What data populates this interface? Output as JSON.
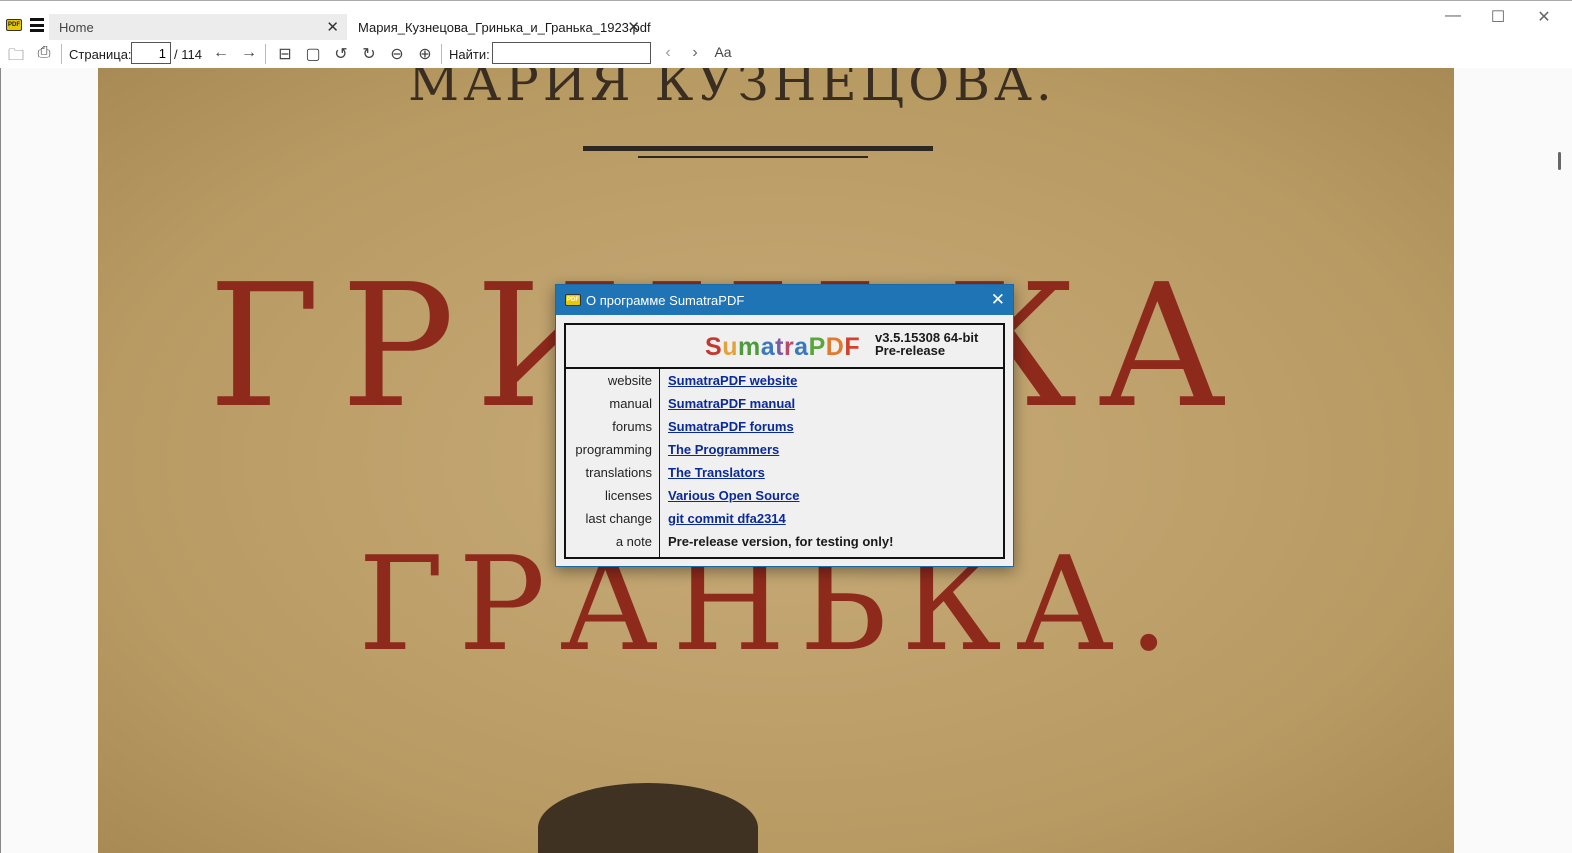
{
  "tabs": {
    "home": "Home",
    "doc": "Мария_Кузнецова_Гринька_и_Гранька_1923.pdf"
  },
  "toolbar": {
    "page_label": "Страница:",
    "page_value": "1",
    "page_total": "/ 114",
    "find_label": "Найти:",
    "find_value": "",
    "match_case": "Aa"
  },
  "document": {
    "author": "МАРИЯ КУЗНЕЦОВА.",
    "title1": "ГРИНЬКА",
    "title2": "ГРАНЬКА."
  },
  "dialog": {
    "title": "О программе SumatraPDF",
    "brand_letters": [
      {
        "c": "S",
        "color": "#c8372d"
      },
      {
        "c": "u",
        "color": "#e3a33a"
      },
      {
        "c": "m",
        "color": "#4f9a3c"
      },
      {
        "c": "a",
        "color": "#3a79bd"
      },
      {
        "c": "t",
        "color": "#7c5aa6"
      },
      {
        "c": "r",
        "color": "#b84a6a"
      },
      {
        "c": "a",
        "color": "#3a79bd"
      },
      {
        "c": "P",
        "color": "#5aa63a"
      },
      {
        "c": "D",
        "color": "#e07a2f"
      },
      {
        "c": "F",
        "color": "#d2402e"
      }
    ],
    "version": "v3.5.15308 64-bit",
    "release": "Pre-release",
    "rows": [
      {
        "key": "website",
        "value": "SumatraPDF website",
        "link": true
      },
      {
        "key": "manual",
        "value": "SumatraPDF manual",
        "link": true
      },
      {
        "key": "forums",
        "value": "SumatraPDF forums",
        "link": true
      },
      {
        "key": "programming",
        "value": "The Programmers",
        "link": true
      },
      {
        "key": "translations",
        "value": "The Translators",
        "link": true
      },
      {
        "key": "licenses",
        "value": "Various Open Source",
        "link": true
      },
      {
        "key": "last change",
        "value": "git commit dfa2314",
        "link": true
      },
      {
        "key": "a note",
        "value": "Pre-release version, for testing only!",
        "link": false
      }
    ]
  }
}
